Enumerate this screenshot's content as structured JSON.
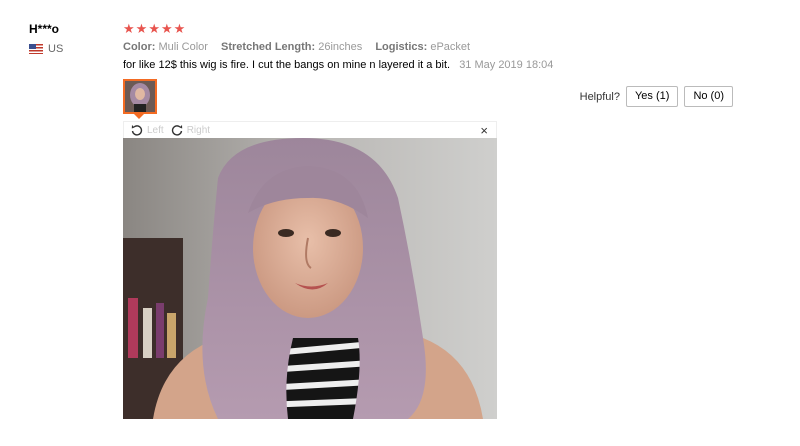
{
  "user": {
    "name": "H***o",
    "country": "US",
    "flag_icon": "us-flag-icon"
  },
  "review": {
    "stars": 5,
    "star_color": "#e8544e",
    "attributes": [
      {
        "label": "Color:",
        "value": "Muli Color"
      },
      {
        "label": "Stretched Length:",
        "value": "26inches"
      },
      {
        "label": "Logistics:",
        "value": "ePacket"
      }
    ],
    "text": "for like 12$ this wig is fire. I cut the bangs on mine n layered it a bit.",
    "date": "31 May 2019 18:04"
  },
  "helpful": {
    "label": "Helpful?",
    "yes": "Yes (1)",
    "no": "No (0)"
  },
  "viewer": {
    "rotate_left": "Left",
    "rotate_right": "Right",
    "close": "×"
  },
  "colors": {
    "accent": "#f36b23"
  }
}
